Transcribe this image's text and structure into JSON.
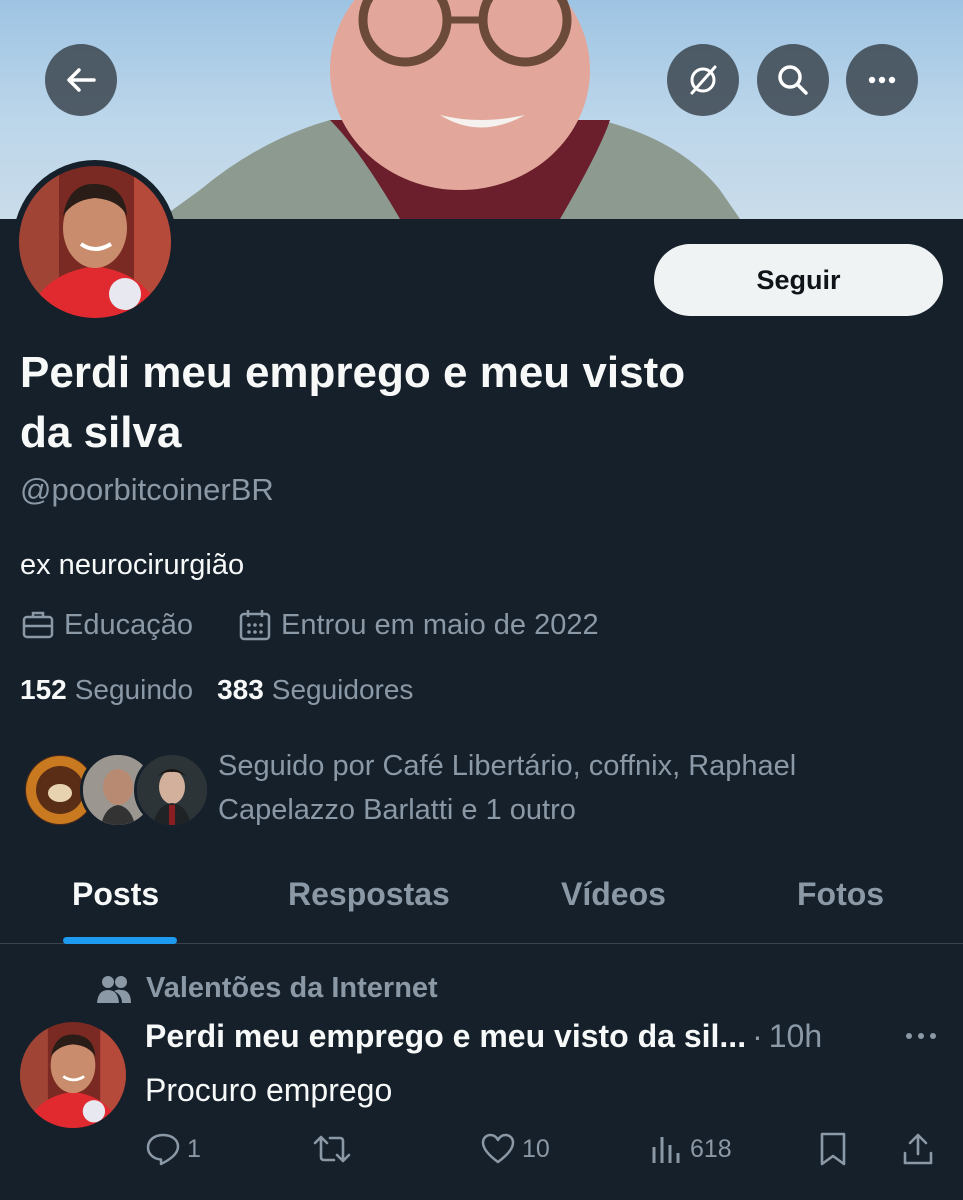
{
  "profile": {
    "display_name_line1": "Perdi meu emprego e meu visto",
    "display_name_line2": "da silva",
    "handle": "@poorbitcoinerBR",
    "bio": "ex neurocirurgião",
    "category": "Educação",
    "joined": "Entrou em maio de 2022",
    "following_count": "152",
    "following_label": "Seguindo",
    "followers_count": "383",
    "followers_label": "Seguidores",
    "followed_by_text": "Seguido por Café Libertário, coffnix, Raphael Capelazzo Barlatti e 1 outro",
    "follow_button": "Seguir"
  },
  "header": {
    "icons": [
      "back-arrow-icon",
      "grok-icon",
      "search-icon",
      "more-icon"
    ]
  },
  "tabs": [
    {
      "label": "Posts",
      "active": true
    },
    {
      "label": "Respostas",
      "active": false
    },
    {
      "label": "Vídeos",
      "active": false
    },
    {
      "label": "Fotos",
      "active": false
    }
  ],
  "post": {
    "community": "Valentões da Internet",
    "author": "Perdi meu emprego e meu visto da sil...",
    "separator": "·",
    "time": "10h",
    "text": "Procuro emprego",
    "replies": "1",
    "retweets": "",
    "likes": "10",
    "views": "618"
  },
  "colors": {
    "background": "#15202b",
    "text": "#f7f9f9",
    "muted": "#8b98a5",
    "accent": "#1d9bf0",
    "button": "#eff3f4"
  }
}
